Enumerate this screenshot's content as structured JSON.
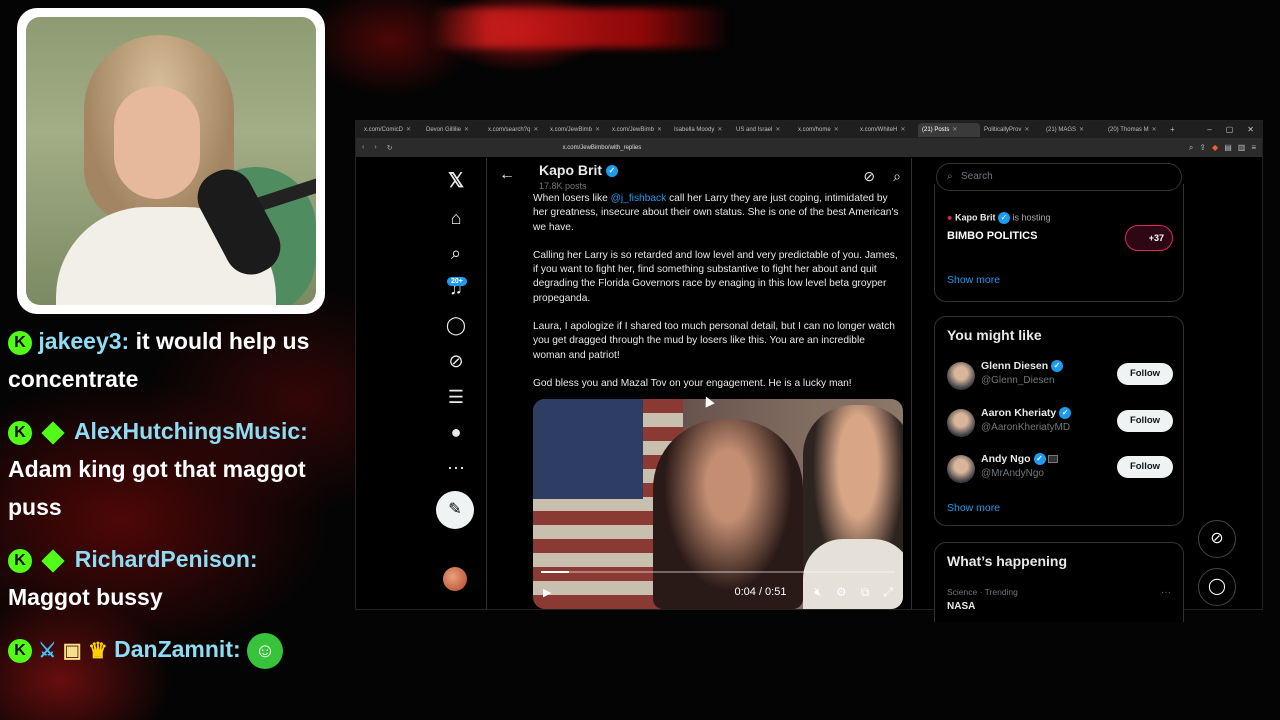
{
  "chat": {
    "messages": [
      {
        "user": "jakeey3:",
        "text": "it would help us concentrate",
        "badges": [
          "kick-badge"
        ]
      },
      {
        "user": "AlexHutchingsMusic:",
        "text": "Adam king got that maggot puss",
        "badges": [
          "kick-badge",
          "gem-badge"
        ]
      },
      {
        "user": "RichardPenison:",
        "text": "Maggot bussy",
        "badges": [
          "kick-badge",
          "gem-badge"
        ]
      },
      {
        "user": "DanZamnit:",
        "text": "",
        "badges": [
          "kick-badge",
          "sword-badge",
          "gift-badge",
          "crown-badge"
        ],
        "emote": "green-emote"
      }
    ],
    "badge_letter": "K"
  },
  "browser": {
    "tabs": [
      {
        "label": "x.com/ComicD"
      },
      {
        "label": "Devon Gillilie"
      },
      {
        "label": "x.com/search?q"
      },
      {
        "label": "x.com/JewBimb"
      },
      {
        "label": "x.com/JewBimb"
      },
      {
        "label": "Isabella Moody"
      },
      {
        "label": "US and Israel"
      },
      {
        "label": "x.com/home"
      },
      {
        "label": "x.com/WhiteH"
      },
      {
        "label": "(21) Posts",
        "active": true
      },
      {
        "label": "PoliticallyProv"
      },
      {
        "label": "(21) MAGS"
      },
      {
        "label": "(20) Thomas M"
      }
    ],
    "url": "x.com/JewBimbo/with_replies"
  },
  "x": {
    "nav": {
      "notifications_count": "20+"
    },
    "profile": {
      "name": "Kapo Brit",
      "posts": "17.8K posts"
    },
    "tweet": {
      "p1_prefix": "When losers like ",
      "p1_mention": "@j_fishback",
      "p1_suffix": " call her Larry they are just coping, intimidated by her greatness, insecure about their own status. She is one of the best American's we have.",
      "p2": "Calling her Larry is so retarded and low level and very predictable of you. James, if you want to fight her, find something substantive to fight her about and quit degrading the Florida Governors race by enaging in this low level beta groyper propeganda.",
      "p3": "Laura, I apologize if I shared too much personal detail, but I can no longer watch you get dragged through the mud by losers like this. You are an incredible woman and patriot!",
      "p4": "God bless you and Mazal Tov on your engagement. He is a lucky man!"
    },
    "video": {
      "time": "0:04 / 0:51",
      "progress": 0.078
    },
    "sidebar": {
      "search_placeholder": "Search",
      "space": {
        "host": "Kapo Brit",
        "hosting": "is hosting",
        "title": "BIMBO POLITICS",
        "listeners": "+37",
        "show_more": "Show more"
      },
      "might_like": {
        "title": "You might like",
        "people": [
          {
            "name": "Glenn Diesen",
            "handle": "@Glenn_Diesen",
            "button": "Follow"
          },
          {
            "name": "Aaron Kheriaty",
            "handle": "@AaronKheriatyMD",
            "button": "Follow"
          },
          {
            "name": "Andy Ngo",
            "handle": "@MrAndyNgo",
            "button": "Follow"
          }
        ],
        "show_more": "Show more"
      },
      "happening": {
        "title": "What’s happening",
        "context": "Science · Trending",
        "trend": "NASA",
        "more": "···"
      }
    }
  }
}
